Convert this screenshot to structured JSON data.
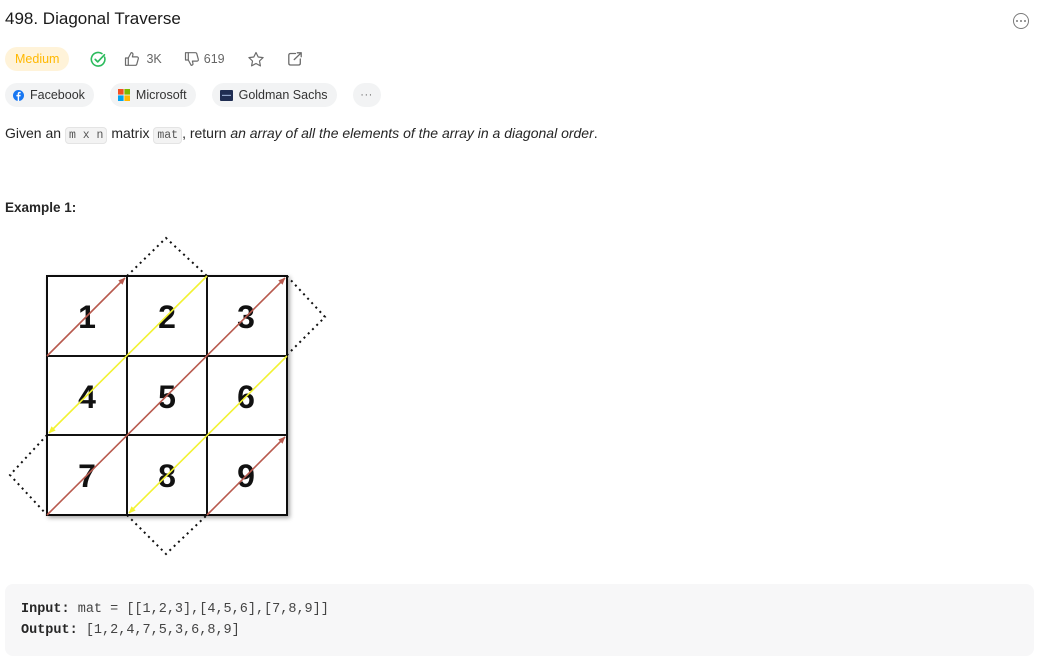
{
  "header": {
    "title": "498. Diagonal Traverse"
  },
  "meta": {
    "difficulty": "Medium",
    "likes": "3K",
    "dislikes": "619",
    "colors": {
      "medium": "#ffb800",
      "solved": "#2cbb5d"
    }
  },
  "companies": [
    {
      "name": "Facebook",
      "icon": "facebook-logo-icon"
    },
    {
      "name": "Microsoft",
      "icon": "microsoft-logo-icon"
    },
    {
      "name": "Goldman Sachs",
      "icon": "goldman-sachs-logo-icon"
    }
  ],
  "more_tags_label": "···",
  "description": {
    "part1": "Given an ",
    "code1": "m x n",
    "part2": " matrix ",
    "code2": "mat",
    "part3": ", return ",
    "emphasis": "an array of all the elements of the array in a diagonal order",
    "part4": "."
  },
  "example": {
    "title": "Example 1:",
    "matrix": [
      [
        "1",
        "2",
        "3"
      ],
      [
        "4",
        "5",
        "6"
      ],
      [
        "7",
        "8",
        "9"
      ]
    ],
    "input_label": "Input:",
    "input_value": "mat = [[1,2,3],[4,5,6],[7,8,9]]",
    "output_label": "Output:",
    "output_value": "[1,2,4,7,5,3,6,8,9]"
  }
}
